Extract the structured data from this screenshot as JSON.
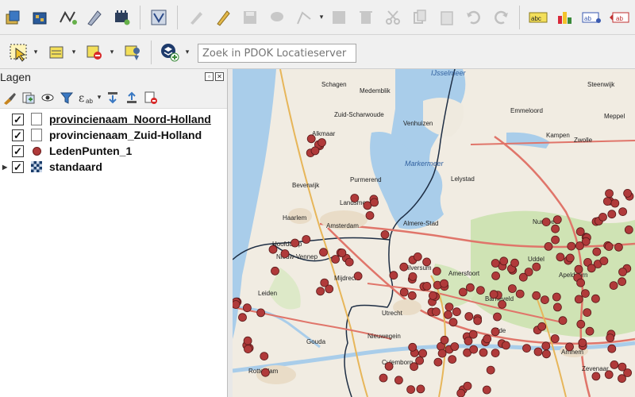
{
  "toolbar_top": {
    "icons": [
      "new-layer-icon",
      "add-raster-icon",
      "add-vector-icon",
      "digitize-icon",
      "add-module-icon",
      "processing-icon",
      "pencil-icon",
      "edit-icon",
      "save-icon",
      "add-feature-icon",
      "vertex-icon",
      "attribute-icon",
      "delete-icon",
      "cut-icon",
      "copy-icon",
      "paste-icon",
      "undo-icon",
      "redo-icon",
      "label-abc-icon",
      "diagram-icon",
      "label-pin-icon",
      "label-move-icon"
    ]
  },
  "toolbar_second": {
    "search_placeholder": "Zoek in PDOK Locatieserver"
  },
  "layers_panel": {
    "title": "Lagen",
    "layers": [
      {
        "name": "provincienaam_Noord-Holland",
        "checked": true,
        "symbol": "box",
        "selected": true
      },
      {
        "name": "provincienaam_Zuid-Holland",
        "checked": true,
        "symbol": "box",
        "selected": false
      },
      {
        "name": "LedenPunten_1",
        "checked": true,
        "symbol": "dot",
        "selected": false
      },
      {
        "name": "standaard",
        "checked": true,
        "symbol": "raster",
        "selected": false
      }
    ]
  },
  "map": {
    "water_labels": [
      "IJsselmeer",
      "Markermeer"
    ],
    "place_labels": [
      "Schagen",
      "Medemblik",
      "Zuid-Scharwoude",
      "Alkmaar",
      "Venhuizen",
      "Emmeloord",
      "Steenwijk",
      "Meppel",
      "Kampen",
      "Zwolle",
      "Purmerend",
      "Lelystad",
      "Beverwijk",
      "Landsmeer",
      "Haarlem",
      "Amsterdam",
      "Almere-Stad",
      "Nunspeet",
      "Hoofddorp",
      "Nieuw-Vennep",
      "Hilversum",
      "Uddel",
      "Apeldoorn",
      "Leiden",
      "Mijdrecht",
      "Amersfoort",
      "Barneveld",
      "Utrecht",
      "Ede",
      "Gouda",
      "Nieuwegein",
      "Arnhem",
      "Rotterdam",
      "Culemborg",
      "Zevenaar"
    ],
    "point_color": "#b03a3a"
  }
}
